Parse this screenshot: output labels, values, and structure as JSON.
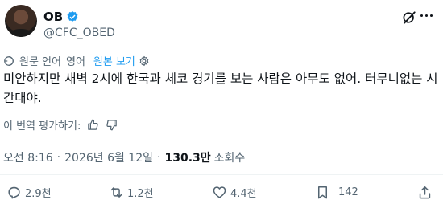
{
  "author": {
    "name": "OB",
    "handle": "@CFC_OBED"
  },
  "translation_bar": {
    "source_label": "원문 언어",
    "source_language": "영어",
    "view_original": "원본 보기"
  },
  "tweet": {
    "text": "미안하지만 새벽 2시에 한국과 체코 경기를 보는 사람은 아무도 없어. 터무니없는 시간대야."
  },
  "rate_translation": {
    "label": "이 번역 평가하기:"
  },
  "meta": {
    "time": "오전 8:16",
    "date": "2026년 6월 12일",
    "views_count": "130.3만",
    "views_label": "조회수"
  },
  "actions": {
    "replies": "2.9천",
    "reposts": "1.2천",
    "likes": "4.4천",
    "bookmarks": "142"
  },
  "colors": {
    "verified": "#1d9bf0",
    "link": "#1d9bf0",
    "secondary_text": "#536471"
  }
}
